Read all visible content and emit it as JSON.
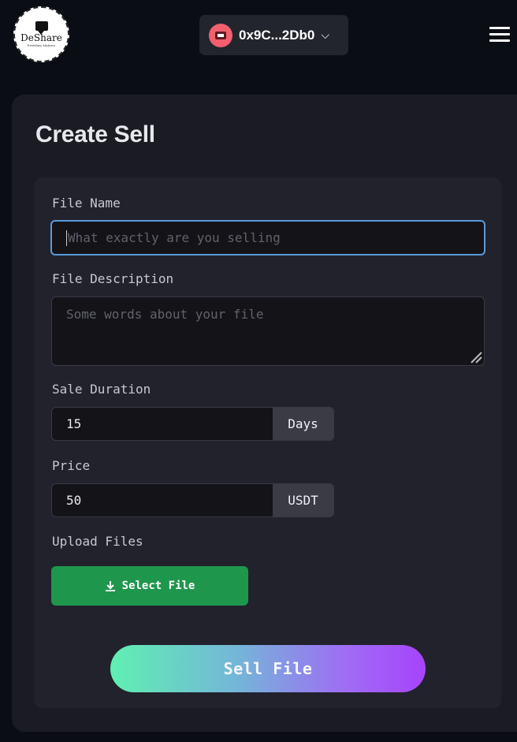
{
  "header": {
    "logo": {
      "name": "DeShare",
      "tagline": "Freedom Matters"
    },
    "wallet": {
      "address": "0x9C...2Db0",
      "avatar_color": "#f35f6d"
    },
    "menu_icon": "hamburger-menu-icon"
  },
  "page": {
    "title": "Create Sell"
  },
  "form": {
    "file_name": {
      "label": "File Name",
      "placeholder": "What exactly are you selling",
      "value": ""
    },
    "file_description": {
      "label": "File Description",
      "placeholder": "Some words about your file",
      "value": ""
    },
    "sale_duration": {
      "label": "Sale Duration",
      "value": "15",
      "unit": "Days"
    },
    "price": {
      "label": "Price",
      "value": "50",
      "unit": "USDT"
    },
    "upload": {
      "label": "Upload Files",
      "button_label": "Select File",
      "icon": "download-icon"
    },
    "submit_label": "Sell File"
  },
  "colors": {
    "background": "#0b0d15",
    "card": "#1b1b24",
    "panel": "#22222d",
    "focus_border": "#5b9ad8",
    "select_button": "#1e974c",
    "gradient_start": "#5ff0b1",
    "gradient_end": "#a644fb"
  }
}
